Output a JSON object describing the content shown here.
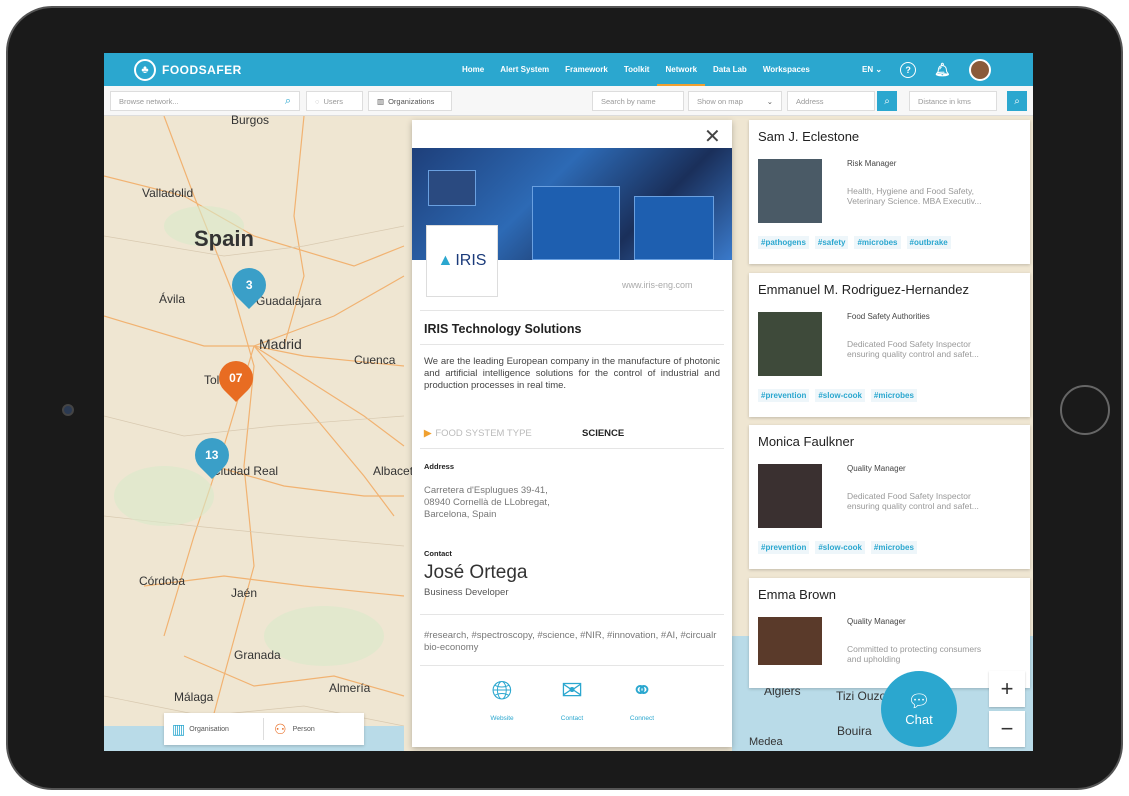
{
  "brand": {
    "name": "FOODSAFER"
  },
  "nav": {
    "links": [
      "Home",
      "Alert System",
      "Framework",
      "Toolkit",
      "Network",
      "Data Lab",
      "Workspaces"
    ],
    "language": "EN",
    "help_icon": "question-icon",
    "bell_icon": "bell-icon"
  },
  "search": {
    "browse_placeholder": "Browse network...",
    "users_label": "Users",
    "organizations_label": "Organizations",
    "name_placeholder": "Search by name",
    "show_on_map": "Show on map",
    "address_placeholder": "Address",
    "distance_placeholder": "Distance in kms"
  },
  "map": {
    "labels": [
      "Burgos",
      "Valladolid",
      "Spain",
      "Ávila",
      "Guadalajara",
      "Madrid",
      "Cuenca",
      "Toledo",
      "Ciudad Real",
      "Albacete",
      "Córdoba",
      "Jaén",
      "Granada",
      "Almería",
      "Málaga",
      "Algiers",
      "Tizi Ouzou",
      "Bouira",
      "Medea"
    ],
    "clusters": [
      {
        "count": "3",
        "color": "#3a9fc8"
      },
      {
        "count": "07",
        "color": "#e86c22"
      },
      {
        "count": "13",
        "color": "#3a9fc8"
      }
    ]
  },
  "org": {
    "close": "✕",
    "logo_text": "IRIS",
    "website": "www.iris-eng.com",
    "name": "IRIS Technology Solutions",
    "description": "We are the leading European company in the manufacture of photonic and artificial intelligence solutions for the control of industrial and production processes in real time.",
    "food_system_label": "FOOD SYSTEM TYPE",
    "food_system_value": "SCIENCE",
    "address_label": "Address",
    "address_lines": [
      "Carretera d'Esplugues 39-41,",
      "08940 Cornellà de LLobregat,",
      "Barcelona, Spain"
    ],
    "contact_label": "Contact",
    "contact_name": "José Ortega",
    "contact_role": "Business Developer",
    "tags": "#research, #spectroscopy, #science, #NIR, #innovation, #AI, #circualr bio-economy",
    "actions": [
      {
        "label": "Website",
        "icon": "globe-icon"
      },
      {
        "label": "Contact",
        "icon": "contact-icon"
      },
      {
        "label": "Connect",
        "icon": "handshake-icon"
      }
    ]
  },
  "people": [
    {
      "name": "Sam J. Eclestone",
      "role": "Risk Manager",
      "desc": "Health, Hygiene and Food Safety, Veterinary Science. MBA Executiv...",
      "tags": [
        "#pathogens",
        "#safety",
        "#microbes",
        "#outbrake"
      ]
    },
    {
      "name": "Emmanuel M. Rodriguez-Hernandez",
      "role": "Food Safety Authorities",
      "desc": "Dedicated Food Safety Inspector ensuring quality control and safet...",
      "tags": [
        "#prevention",
        "#slow-cook",
        "#microbes"
      ]
    },
    {
      "name": "Monica Faulkner",
      "role": "Quality Manager",
      "desc": "Dedicated Food Safety Inspector ensuring quality control and safet...",
      "tags": [
        "#prevention",
        "#slow-cook",
        "#microbes"
      ]
    },
    {
      "name": "Emma Brown",
      "role": "Quality Manager",
      "desc": "Committed to protecting consumers and upholding",
      "tags": []
    }
  ],
  "legend": {
    "organisation": "Organisation",
    "person": "Person"
  },
  "chat": {
    "label": "Chat"
  },
  "zoom": {
    "in": "+",
    "out": "−"
  }
}
